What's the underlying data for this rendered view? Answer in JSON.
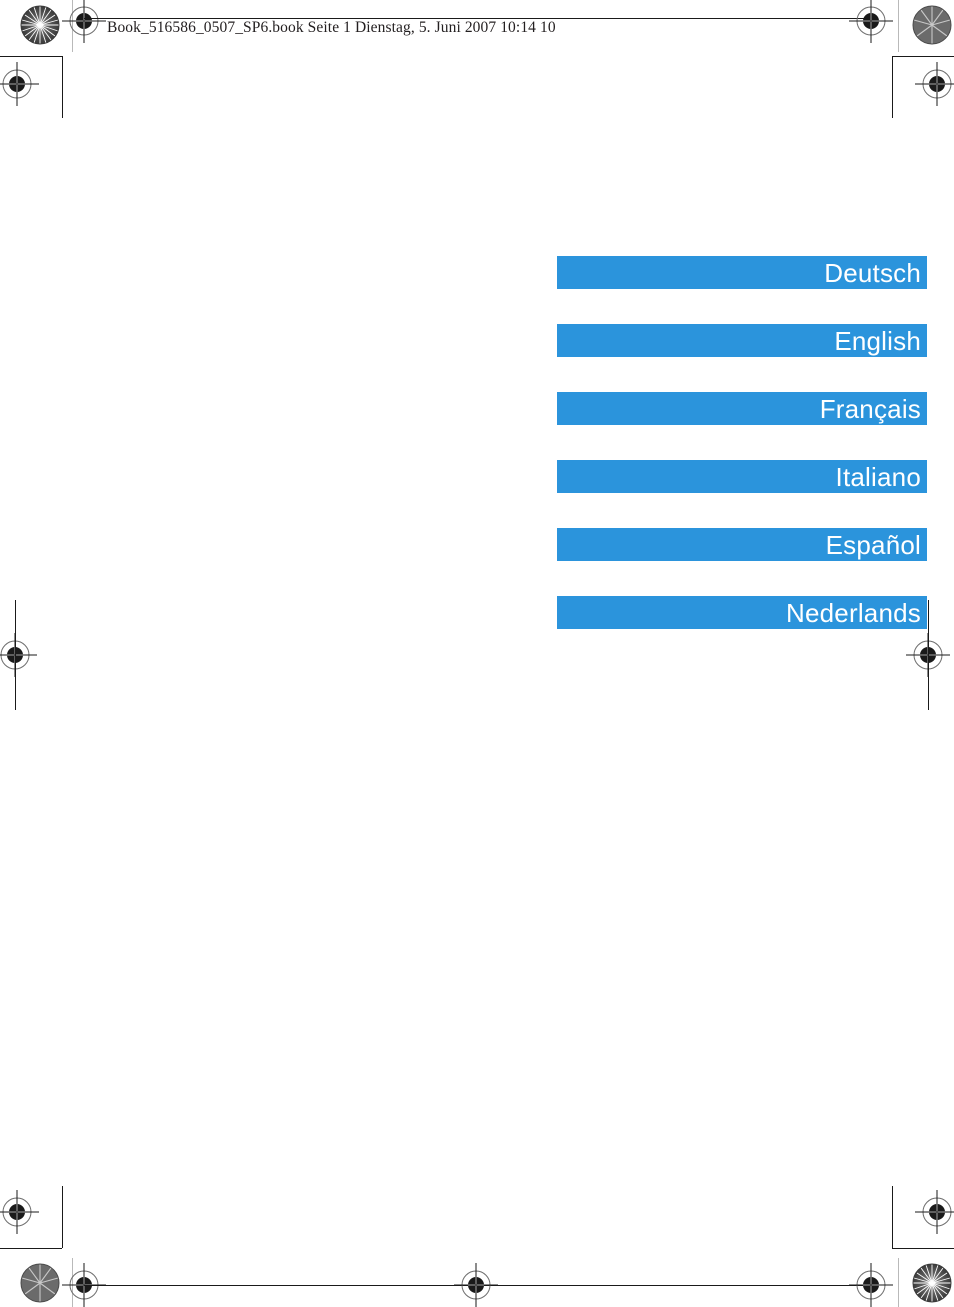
{
  "page": {
    "header_note": "Book_516586_0507_SP6.book  Seite 1  Dienstag, 5. Juni 2007  10:14 10"
  },
  "colors": {
    "bar_blue": "#2b94dc",
    "bar_label": "#ffffff",
    "print_mark": "#231f20"
  },
  "languages": {
    "items": [
      {
        "label": "Deutsch"
      },
      {
        "label": "English"
      },
      {
        "label": "Français"
      },
      {
        "label": "Italiano"
      },
      {
        "label": "Español"
      },
      {
        "label": "Nederlands"
      }
    ]
  },
  "print_marks": {
    "registration_icon": "registration-crosshair-icon",
    "star_icon": "star-target-icon"
  }
}
